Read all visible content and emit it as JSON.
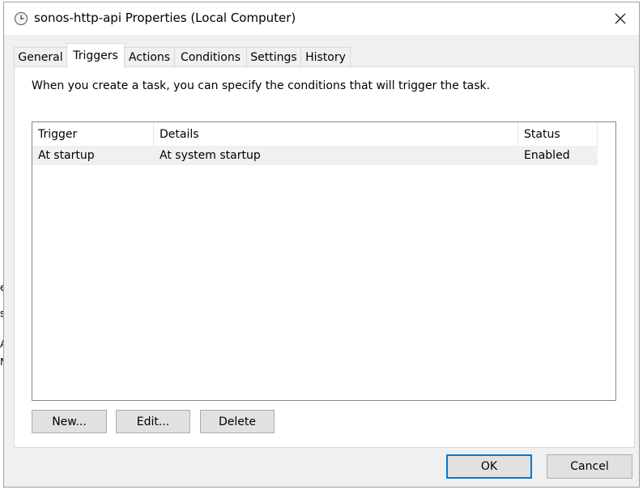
{
  "background_window": {
    "edge_chars": [
      "e",
      "s",
      "A",
      "N"
    ]
  },
  "window": {
    "title": "sonos-http-api Properties (Local Computer)",
    "icon": "clock-icon",
    "close_icon": "close-icon"
  },
  "tabs": [
    {
      "label": "General",
      "active": false
    },
    {
      "label": "Triggers",
      "active": true
    },
    {
      "label": "Actions",
      "active": false
    },
    {
      "label": "Conditions",
      "active": false
    },
    {
      "label": "Settings",
      "active": false
    },
    {
      "label": "History",
      "active": false
    }
  ],
  "triggers": {
    "description": "When you create a task, you can specify the conditions that will trigger the task.",
    "columns": [
      "Trigger",
      "Details",
      "Status"
    ],
    "rows": [
      {
        "trigger": "At startup",
        "details": "At system startup",
        "status": "Enabled"
      }
    ],
    "new_label": "New...",
    "edit_label": "Edit...",
    "delete_label": "Delete"
  },
  "footer": {
    "ok_label": "OK",
    "cancel_label": "Cancel"
  },
  "colors": {
    "dialog_bg": "#f0f0f0",
    "default_button_border": "#0078d7",
    "selected_row_bg": "#f0f0f0"
  }
}
